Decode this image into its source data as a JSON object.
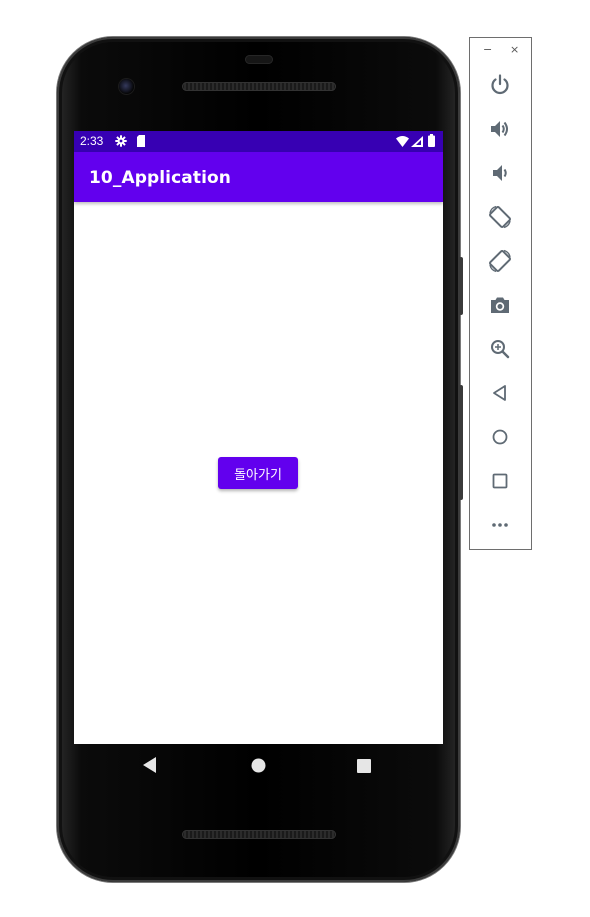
{
  "status_bar": {
    "time": "2:33",
    "icons": [
      "gear-icon",
      "sd-card-icon",
      "wifi-icon",
      "signal-icon",
      "battery-icon"
    ],
    "color": "#3700B3"
  },
  "app_bar": {
    "title": "10_Application",
    "color": "#6200EE"
  },
  "content": {
    "button_label": "돌아가기",
    "button_color": "#6200EE"
  },
  "nav_bar": {
    "buttons": [
      "back-icon",
      "home-icon",
      "recents-icon"
    ]
  },
  "emulator_toolbar": {
    "window_controls": {
      "minimize": "−",
      "close": "×"
    },
    "buttons": [
      "power-icon",
      "volume-up-icon",
      "volume-down-icon",
      "rotate-left-icon",
      "rotate-right-icon",
      "camera-icon",
      "zoom-icon",
      "back-icon",
      "home-icon",
      "overview-icon",
      "more-icon"
    ]
  }
}
